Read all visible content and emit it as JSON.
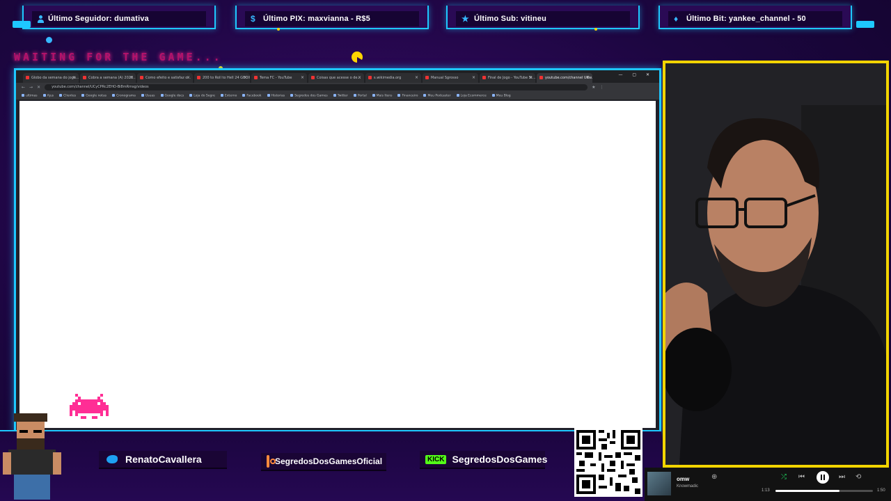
{
  "alerts": [
    {
      "label": "Último Seguidor: dumativa",
      "icon": "person-icon"
    },
    {
      "label": "Último PIX: maxvianna - R$5",
      "icon": "dollar-icon"
    },
    {
      "label": "Último Sub: vitineu",
      "icon": "star-icon"
    },
    {
      "label": "Último Bit: yankee_channel - 50",
      "icon": "gem-icon"
    }
  ],
  "overlay": {
    "waiting_text": "WAITING FOR THE GAME...",
    "qr_url": "livepix.gg/segredosdosgames"
  },
  "browser": {
    "tabs": [
      {
        "title": "Globo da semana do jogo..."
      },
      {
        "title": "Cobra a semana (A) 2023..."
      },
      {
        "title": "Como efeito e satisfaz o..."
      },
      {
        "title": "200 to Roll to Hell 24 GBOX..."
      },
      {
        "title": "Tema FC - YouTube"
      },
      {
        "title": "Coisas que acesse o de..."
      },
      {
        "title": "s.wikimedia.org"
      },
      {
        "title": "Manual Sgrosso"
      },
      {
        "title": "Final de Jogo - YouTube St..."
      },
      {
        "title": "youtube.com/channel UCw..."
      }
    ],
    "url": "youtube.com/channel/UCyCPRc2EHO-Bi8mRmsg/videos",
    "bookmarks": [
      "ultimas",
      "Ajus",
      "Clientes",
      "Google notas",
      "Cronograma",
      "Usuas",
      "Google docs",
      "Loja do Segre",
      "Externo",
      "Facebook",
      "Historias",
      "Segredos dos Games",
      "Twitter",
      "Portal",
      "Mais Itens",
      "Financeiro",
      "Meu Podcaster",
      "Loja Ecommerce",
      "Meu Blog"
    ]
  },
  "socials": [
    {
      "handle": "RenatoCavallera",
      "icon": "twitter-icon",
      "color": "#1da1f2"
    },
    {
      "handle": "SegredosDosGamesOficial",
      "icon": "instagram-icon",
      "color": "#ff8a3d"
    },
    {
      "handle": "SegredosDosGames",
      "icon": "kick-icon",
      "icon_text": "KICK",
      "color": "#53fc18"
    }
  ],
  "player": {
    "track": "omw",
    "artist": "Knowmadic",
    "elapsed": "1:13",
    "duration": "1:50",
    "progress": 0.66
  },
  "colors": {
    "frame": "#1ec8ff",
    "webcam_border": "#f2d400",
    "background": "#1c0640"
  }
}
